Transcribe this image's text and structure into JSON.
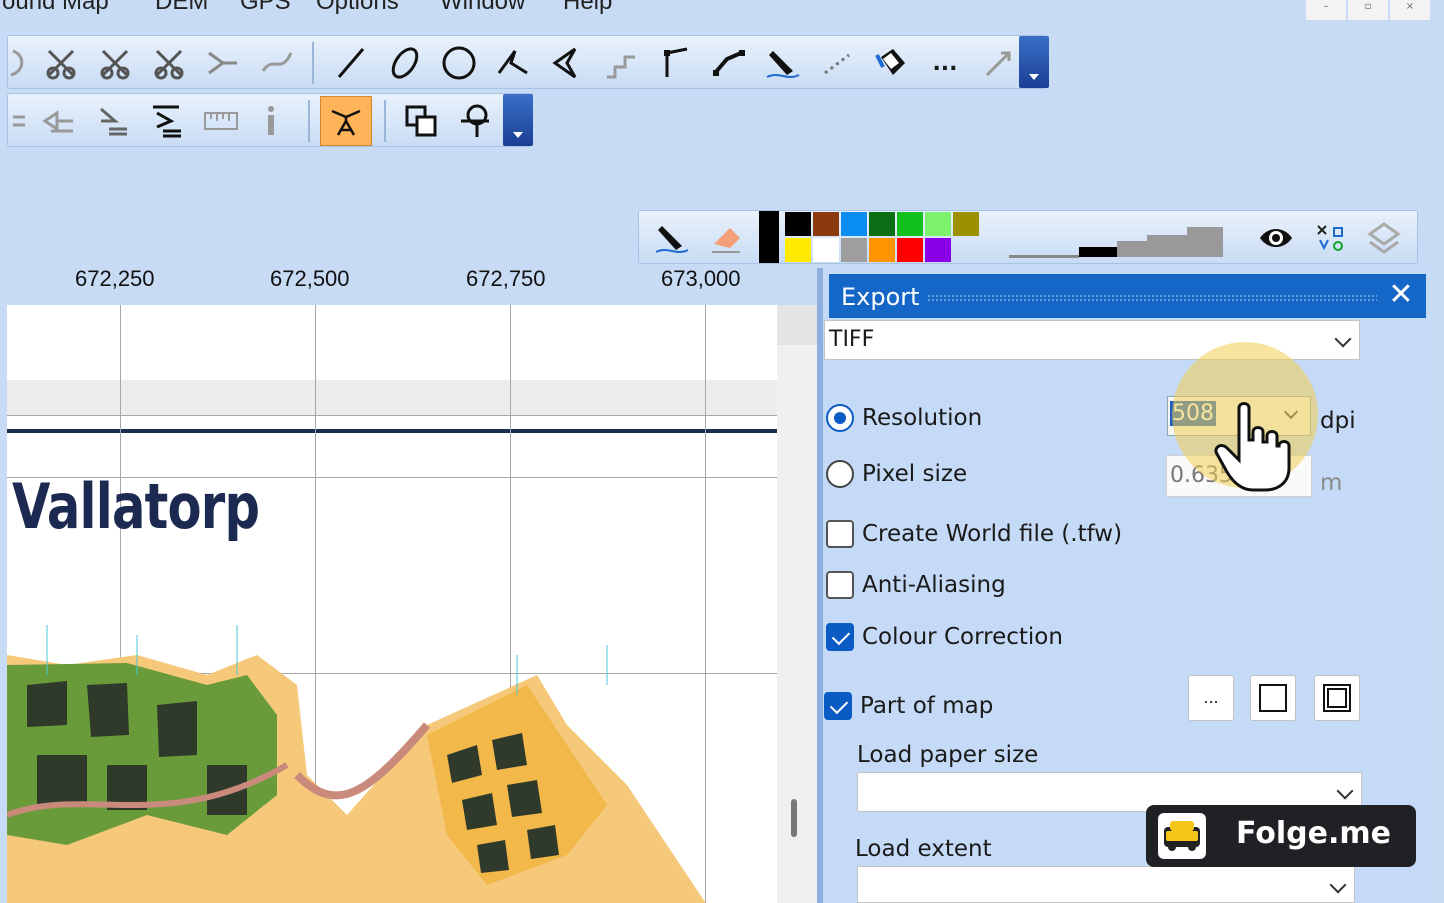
{
  "menu": {
    "items": [
      "ound Map",
      "DEM",
      "GPS",
      "Options",
      "Window",
      "Help"
    ]
  },
  "window_controls": [
    "–",
    "▫",
    "×"
  ],
  "toolbars": {
    "drawing_tools": [
      "undo-icon",
      "cut-hole-icon",
      "cut-area-icon",
      "scissors-icon",
      "merge-icon",
      "smooth-icon",
      "curve-icon",
      "ellipse-icon",
      "circle-icon",
      "freehand-icon",
      "polygon-icon",
      "step-icon",
      "straight-line-icon",
      "line-icon",
      "pen-icon",
      "dotted-line-icon",
      "fill-icon",
      "more-icon",
      "arrow-icon"
    ],
    "more_label": "...",
    "edit_tools": [
      "align-icon",
      "move-icon",
      "place-icon",
      "stack-icon",
      "ruler-icon",
      "info-icon",
      "text-path-icon",
      "copy-icon",
      "join-icon"
    ],
    "palette_colors": [
      "#000000",
      "#000000",
      "#8b3a0e",
      "#0a8df0",
      "#0a6f14",
      "#12c01e",
      "#7df06c",
      "#9a9000",
      "#ffea00",
      "#ffffff",
      "#9e9e9e",
      "#ff9400",
      "#ff0000",
      "#8a00e6"
    ]
  },
  "ruler": {
    "ticks": [
      "672,250",
      "672,500",
      "672,750",
      "673,000"
    ]
  },
  "map": {
    "title": "Vallatorp"
  },
  "export_panel": {
    "title": "Export",
    "close_label": "✕",
    "format": "TIFF",
    "resolution_label": "Resolution",
    "resolution_value": "508",
    "resolution_unit": "dpi",
    "pixel_size_label": "Pixel size",
    "pixel_size_value": "0.6350000",
    "pixel_size_unit": "m",
    "world_file_label": "Create World file (.tfw)",
    "anti_aliasing_label": "Anti-Aliasing",
    "colour_correction_label": "Colour Correction",
    "part_of_map_label": "Part of map",
    "more_button_label": "...",
    "load_paper_size_label": "Load paper size",
    "load_paper_size_value": "",
    "load_extent_label": "Load extent",
    "load_extent_value": ""
  },
  "badge": {
    "text": "Folge.me"
  }
}
